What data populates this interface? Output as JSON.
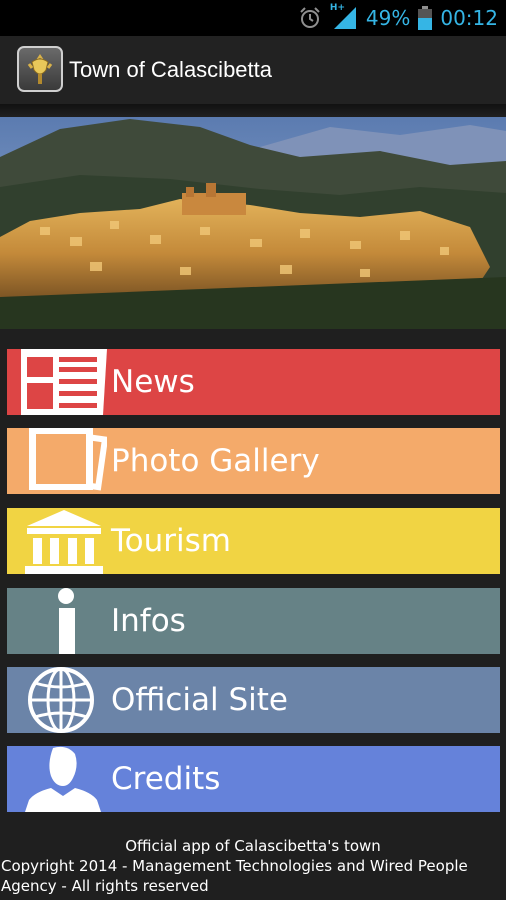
{
  "status": {
    "battery_percent": "49%",
    "time": "00:12",
    "network_type": "H+",
    "alarm_icon": "alarm-clock-icon",
    "signal_icon": "signal-strength-icon",
    "battery_icon": "battery-icon",
    "accent": "#35b5e5"
  },
  "app": {
    "title": "Town of Calascibetta",
    "icon": "town-crest-icon"
  },
  "hero": {
    "image": "town-panorama-photo"
  },
  "menu": [
    {
      "label": "News",
      "color": "#dd4545",
      "icon": "newspaper-icon"
    },
    {
      "label": "Photo Gallery",
      "color": "#f4aa6a",
      "icon": "photos-icon"
    },
    {
      "label": "Tourism",
      "color": "#f1d443",
      "icon": "museum-icon"
    },
    {
      "label": "Infos",
      "color": "#668286",
      "icon": "info-icon"
    },
    {
      "label": "Official Site",
      "color": "#6b84a8",
      "icon": "globe-icon"
    },
    {
      "label": "Credits",
      "color": "#6582da",
      "icon": "person-icon"
    }
  ],
  "footer": {
    "line1": "Official app of Calascibetta's town",
    "line2": "Copyright 2014 - Management Technologies and Wired People",
    "line3": "Agency - All rights reserved"
  }
}
